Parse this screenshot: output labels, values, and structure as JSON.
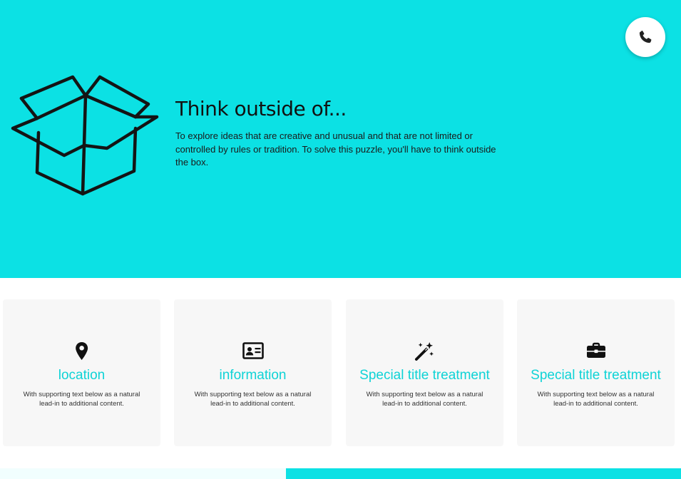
{
  "hero": {
    "title": "Think outside of...",
    "text": "To explore ideas that are creative and unusual and that are not limited or controlled by rules or tradition. To solve this puzzle, you'll have to think outside the box.",
    "background_color": "#0ce1e4",
    "illustration": "open-box-drawing"
  },
  "phone_button": {
    "icon": "phone-icon"
  },
  "cards": [
    {
      "icon": "map-pin-icon",
      "title": "location",
      "text": "With supporting text below as a natural lead-in to additional content."
    },
    {
      "icon": "id-card-icon",
      "title": "information",
      "text": "With supporting text below as a natural lead-in to additional content."
    },
    {
      "icon": "magic-wand-icon",
      "title": "Special title treatment",
      "text": "With supporting text below as a natural lead-in to additional content."
    },
    {
      "icon": "briefcase-icon",
      "title": "Special title treatment",
      "text": "With supporting text below as a natural lead-in to additional content."
    }
  ],
  "colors": {
    "accent": "#0ce1e4",
    "card_title": "#0fd3d6",
    "card_background": "#f7f7f7"
  }
}
